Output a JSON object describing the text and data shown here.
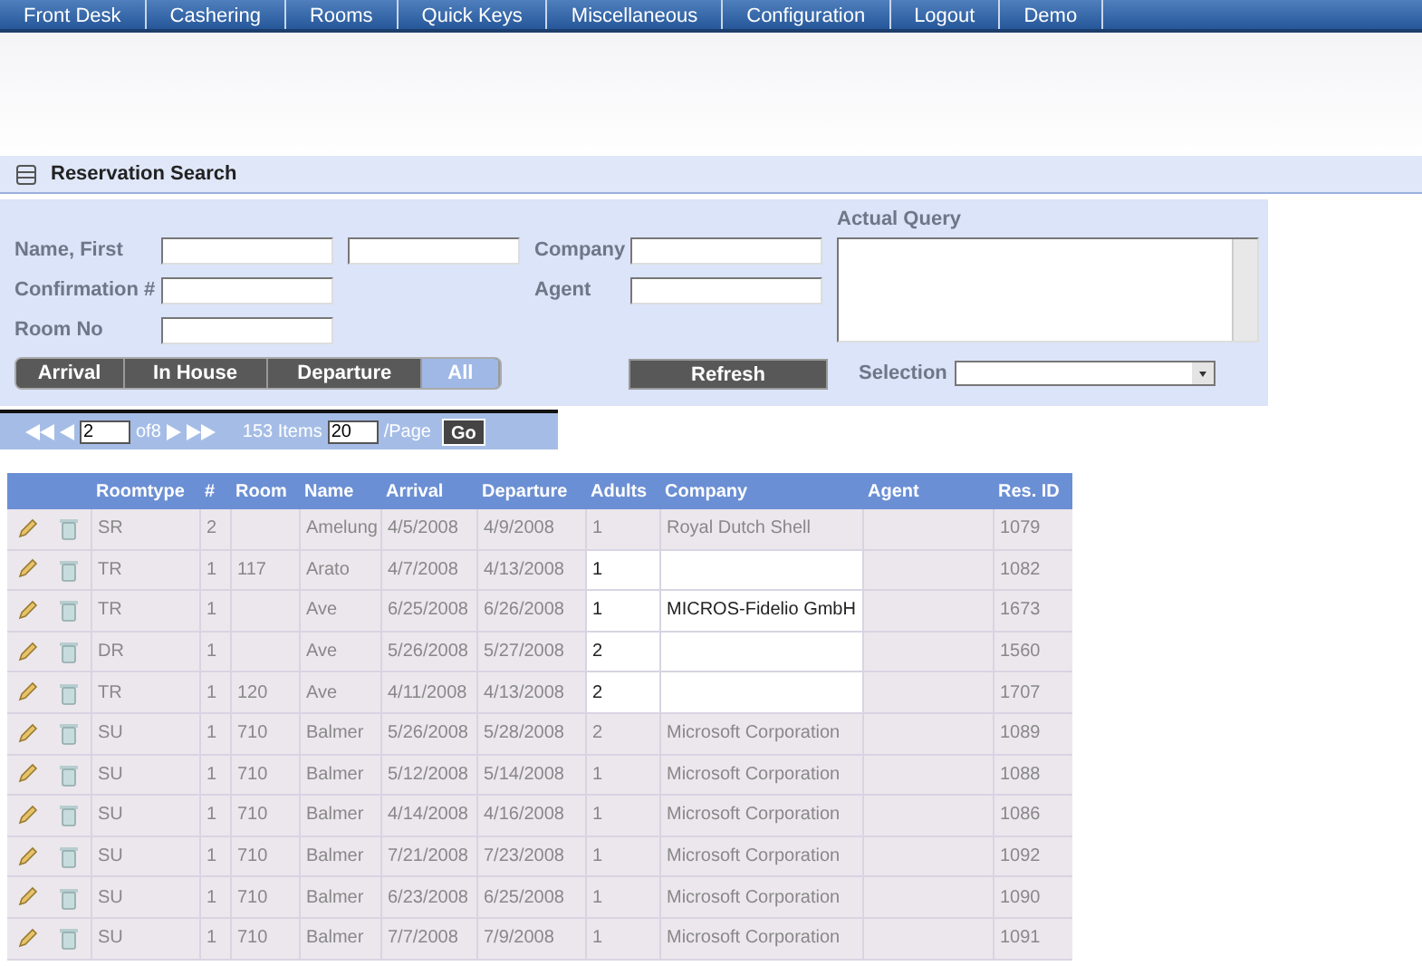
{
  "menu": [
    "Front Desk",
    "Cashering",
    "Rooms",
    "Quick Keys",
    "Miscellaneous",
    "Configuration",
    "Logout",
    "Demo"
  ],
  "panel": {
    "title": "Reservation Search"
  },
  "form": {
    "name_label": "Name, First",
    "confirmation_label": "Confirmation #",
    "room_label": "Room No",
    "company_label": "Company",
    "agent_label": "Agent",
    "query_label": "Actual Query",
    "selection_label": "Selection",
    "refresh": "Refresh",
    "filters": [
      {
        "label": "Arrival",
        "selected": false
      },
      {
        "label": "In House",
        "selected": false
      },
      {
        "label": "Departure",
        "selected": false
      },
      {
        "label": "All",
        "selected": true
      }
    ]
  },
  "pager": {
    "page": "2",
    "of": "of8",
    "items": "153 Items",
    "per_page": "20",
    "per_page_label": "/Page",
    "go": "Go"
  },
  "table": {
    "columns": [
      "Roomtype",
      "#",
      "Room",
      "Name",
      "Arrival",
      "Departure",
      "Adults",
      "Company",
      "Agent",
      "Res. ID"
    ],
    "rows": [
      {
        "cells": [
          "SR",
          "2",
          "",
          "Amelung",
          "4/5/2008",
          "4/9/2008",
          "1",
          "Royal Dutch Shell",
          "",
          "1079"
        ],
        "highlighted": false
      },
      {
        "cells": [
          "TR",
          "1",
          "117",
          "Arato",
          "4/7/2008",
          "4/13/2008",
          "1",
          "",
          "",
          "1082"
        ],
        "highlighted": true
      },
      {
        "cells": [
          "TR",
          "1",
          "",
          "Ave",
          "6/25/2008",
          "6/26/2008",
          "1",
          "MICROS-Fidelio GmbH",
          "",
          "1673"
        ],
        "highlighted": true
      },
      {
        "cells": [
          "DR",
          "1",
          "",
          "Ave",
          "5/26/2008",
          "5/27/2008",
          "2",
          "",
          "",
          "1560"
        ],
        "highlighted": true
      },
      {
        "cells": [
          "TR",
          "1",
          "120",
          "Ave",
          "4/11/2008",
          "4/13/2008",
          "2",
          "",
          "",
          "1707"
        ],
        "highlighted": true
      },
      {
        "cells": [
          "SU",
          "1",
          "710",
          "Balmer",
          "5/26/2008",
          "5/28/2008",
          "2",
          "Microsoft Corporation",
          "",
          "1089"
        ],
        "highlighted": false
      },
      {
        "cells": [
          "SU",
          "1",
          "710",
          "Balmer",
          "5/12/2008",
          "5/14/2008",
          "1",
          "Microsoft Corporation",
          "",
          "1088"
        ],
        "highlighted": false
      },
      {
        "cells": [
          "SU",
          "1",
          "710",
          "Balmer",
          "4/14/2008",
          "4/16/2008",
          "1",
          "Microsoft Corporation",
          "",
          "1086"
        ],
        "highlighted": false
      },
      {
        "cells": [
          "SU",
          "1",
          "710",
          "Balmer",
          "7/21/2008",
          "7/23/2008",
          "1",
          "Microsoft Corporation",
          "",
          "1092"
        ],
        "highlighted": false
      },
      {
        "cells": [
          "SU",
          "1",
          "710",
          "Balmer",
          "6/23/2008",
          "6/25/2008",
          "1",
          "Microsoft Corporation",
          "",
          "1090"
        ],
        "highlighted": false
      },
      {
        "cells": [
          "SU",
          "1",
          "710",
          "Balmer",
          "7/7/2008",
          "7/9/2008",
          "1",
          "Microsoft Corporation",
          "",
          "1091"
        ],
        "highlighted": false
      }
    ]
  }
}
